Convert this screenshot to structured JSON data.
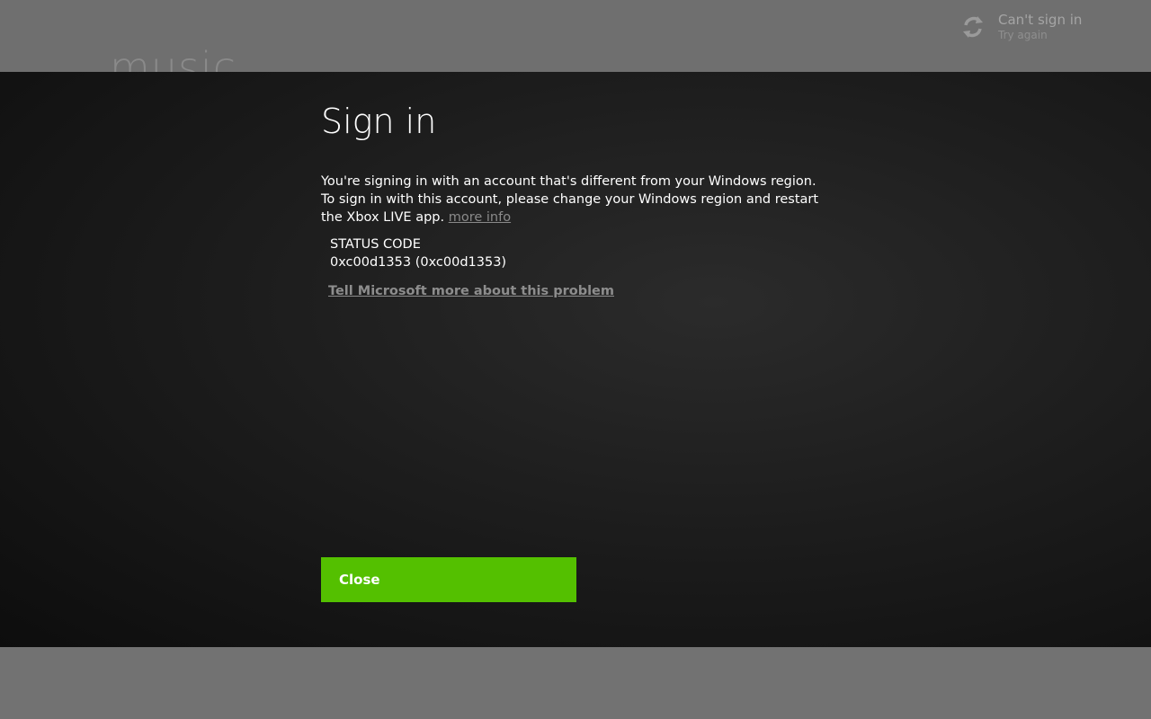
{
  "background": {
    "app_title": "music"
  },
  "status": {
    "icon": "refresh-icon",
    "title": "Can't sign in",
    "subtitle": "Try again"
  },
  "dialog": {
    "title": "Sign in",
    "message": "You're signing in with an account that's different from your Windows region. To sign in with this account, please change your Windows region and restart the Xbox LIVE app.",
    "more_info_link": "more info",
    "status_code_label": "STATUS CODE",
    "status_code_value": "0xc00d1353 (0xc00d1353)",
    "tell_microsoft_link": "Tell Microsoft more about this problem",
    "close_label": "Close"
  },
  "colors": {
    "accent": "#54c000",
    "dialog_bg": "#1d1d1d",
    "link": "#8a8a8a"
  }
}
